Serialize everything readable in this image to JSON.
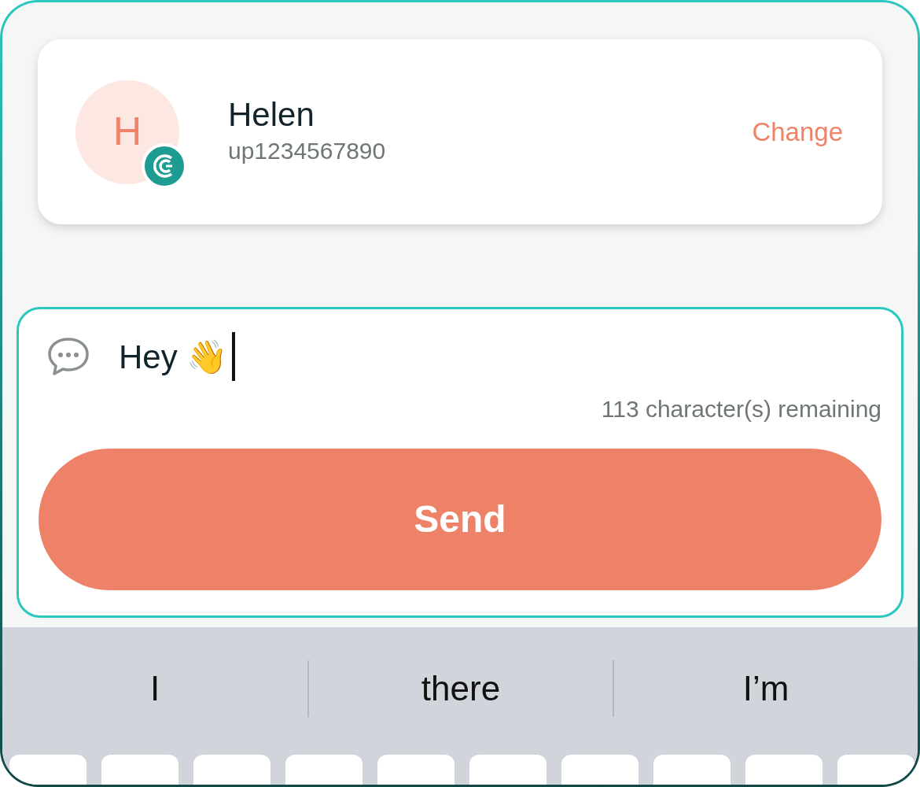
{
  "contact": {
    "initial": "H",
    "name": "Helen",
    "handle": "up1234567890",
    "action": "Change"
  },
  "message": {
    "value": "Hey 👋",
    "counter": "113 character(s) remaining",
    "send": "Send"
  },
  "keyboard": {
    "suggestions": [
      "I",
      "there",
      "I’m"
    ]
  }
}
